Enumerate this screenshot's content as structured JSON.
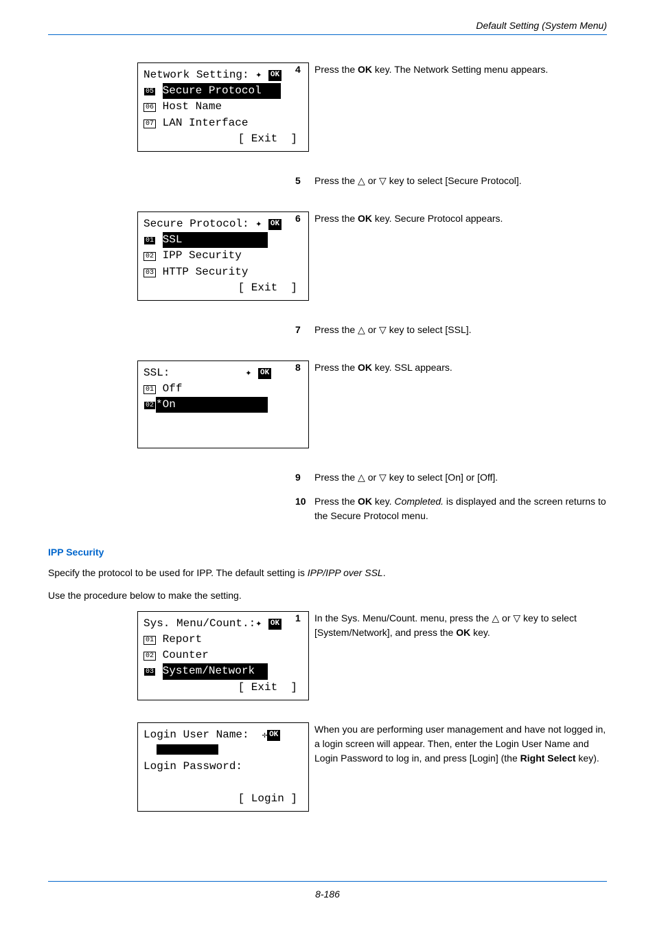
{
  "header": {
    "title": "Default Setting (System Menu)"
  },
  "lcd1": {
    "title": "Network Setting:",
    "nav": "✦",
    "ok": "OK",
    "num_sel": "05",
    "row_sel": "Secure Protocol",
    "num_2": "06",
    "row_2": "Host Name",
    "num_3": "07",
    "row_3": "LAN Interface",
    "softkey": "[ Exit  ]"
  },
  "lcd2": {
    "title": "Secure Protocol:",
    "nav": "✦",
    "ok": "OK",
    "num_sel": "01",
    "row_sel": "SSL",
    "num_2": "02",
    "row_2": "IPP Security",
    "num_3": "03",
    "row_3": "HTTP Security",
    "softkey": "[ Exit  ]"
  },
  "lcd3": {
    "title": "SSL:",
    "nav": "✦",
    "ok": "OK",
    "num_1": "01",
    "row_1": "Off",
    "num_sel": "02",
    "row_sel": "*On"
  },
  "lcd4": {
    "title": "Sys. Menu/Count.:",
    "nav": "✦",
    "ok": "OK",
    "num_1": "01",
    "row_1": "Report",
    "num_2": "02",
    "row_2": "Counter",
    "num_sel": "03",
    "row_sel": "System/Network",
    "softkey": "[ Exit  ]"
  },
  "lcd5": {
    "title": "Login User Name:",
    "ok": "OK",
    "row_2": "Login Password:",
    "softkey": "[ Login ]"
  },
  "steps": {
    "s4": {
      "n": "4",
      "t1": "Press the ",
      "b1": "OK",
      "t2": " key. The Network Setting menu appears."
    },
    "s5": {
      "n": "5",
      "t1": "Press the ",
      "t2": " or ",
      "t3": " key to select [Secure Protocol]."
    },
    "s6": {
      "n": "6",
      "t1": "Press the ",
      "b1": "OK",
      "t2": " key. Secure Protocol appears."
    },
    "s7": {
      "n": "7",
      "t1": "Press the ",
      "t2": " or ",
      "t3": " key to select [SSL]."
    },
    "s8": {
      "n": "8",
      "t1": "Press the ",
      "b1": "OK",
      "t2": " key. SSL appears."
    },
    "s9": {
      "n": "9",
      "t1": "Press the ",
      "t2": " or ",
      "t3": " key to select [On] or [Off]."
    },
    "s10": {
      "n": "10",
      "t1": "Press the ",
      "b1": "OK",
      "t2": " key. ",
      "i1": "Completed.",
      "t3": " is displayed and the screen returns to the Secure Protocol menu."
    },
    "s1b": {
      "n": "1",
      "t1": "In the Sys. Menu/Count. menu, press the ",
      "t2": " or ",
      "t3": " key to select [System/Network], and press the ",
      "b1": "OK",
      "t4": " key."
    },
    "note": {
      "t1": "When you are performing user management and have not logged in, a login screen will appear. Then, enter the Login User Name and Login Password to log in, and press [Login] (the ",
      "b1": "Right Select",
      "t2": " key)."
    }
  },
  "sub": {
    "heading": "IPP Security",
    "p1a": "Specify the protocol to be used for IPP. The default setting is ",
    "p1i": "IPP/IPP over SSL",
    "p1b": ".",
    "p2": "Use the procedure below to make the setting."
  },
  "footer": {
    "page": "8-186"
  }
}
